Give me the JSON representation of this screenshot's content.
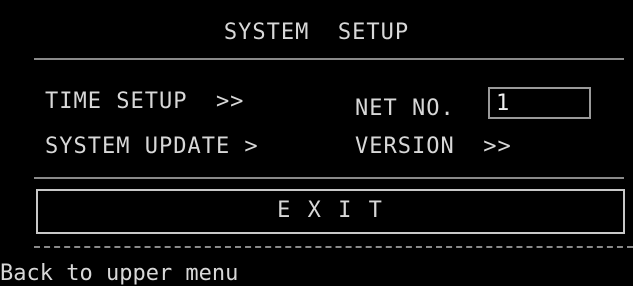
{
  "menu": {
    "title": "SYSTEM  SETUP",
    "items": {
      "time_setup": "TIME SETUP  >>",
      "system_update": "SYSTEM UPDATE >",
      "version": "VERSION  >>"
    },
    "net_no": {
      "label": "NET NO.",
      "value": "1"
    },
    "exit_label": "E X I T"
  },
  "status_bar": {
    "text": "Back to upper menu"
  },
  "colors": {
    "background": "#000000",
    "text": "#d8d8d8",
    "border": "#9a9a9a"
  }
}
